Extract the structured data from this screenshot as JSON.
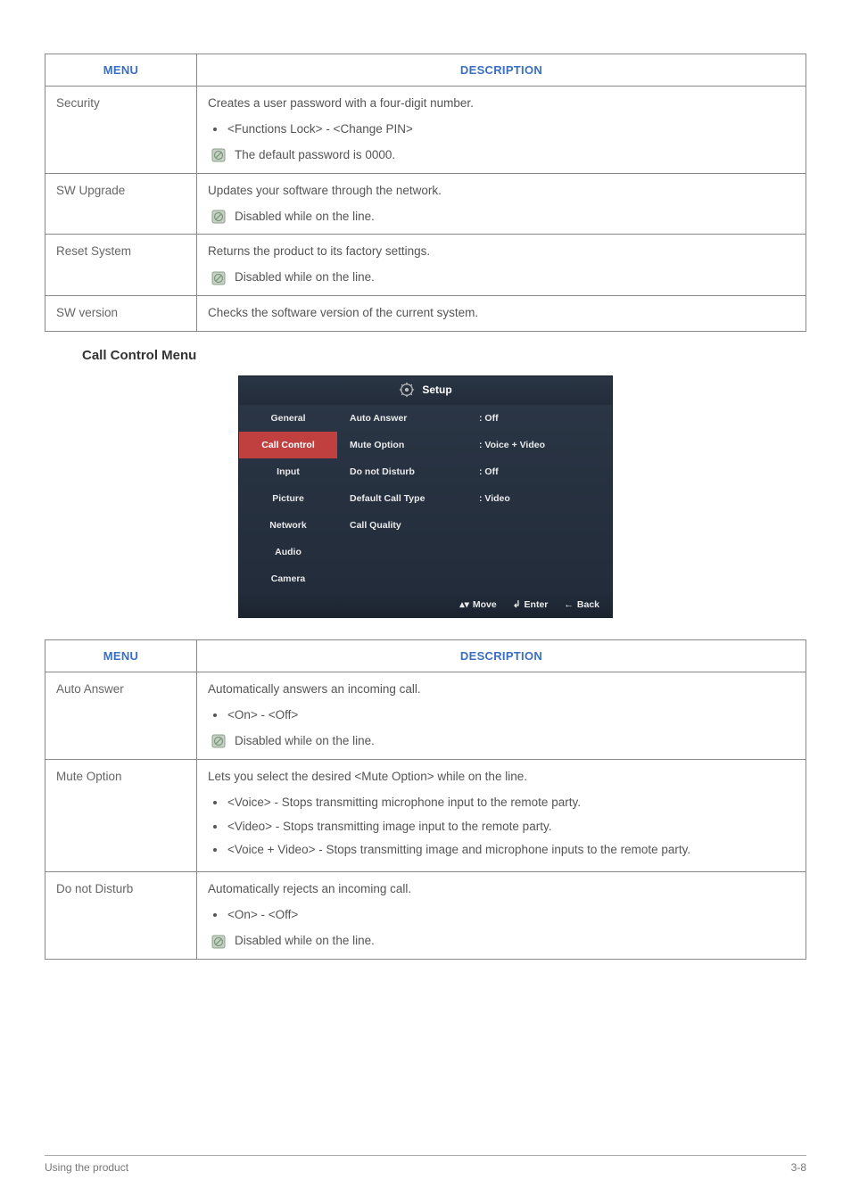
{
  "table1": {
    "head_menu": "MENU",
    "head_desc": "DESCRIPTION",
    "rows": [
      {
        "menu": "Security",
        "desc": "Creates a user password with a four-digit number.",
        "bullets": [
          "<Functions Lock> - <Change PIN>"
        ],
        "note": "The default password is 0000."
      },
      {
        "menu": "SW Upgrade",
        "desc": "Updates your software through the network.",
        "bullets": [],
        "note": "Disabled while on the line."
      },
      {
        "menu": "Reset System",
        "desc": "Returns the product to its factory settings.",
        "bullets": [],
        "note": "Disabled while on the line."
      },
      {
        "menu": "SW version",
        "desc": "Checks the software version of the current system.",
        "bullets": [],
        "note": null
      }
    ]
  },
  "section_heading": "Call Control Menu",
  "osd": {
    "title": "Setup",
    "nav": [
      "General",
      "Call Control",
      "Input",
      "Picture",
      "Network",
      "Audio",
      "Camera"
    ],
    "active_index": 1,
    "rows": [
      {
        "label": "Auto Answer",
        "value": ": Off"
      },
      {
        "label": "Mute Option",
        "value": ": Voice + Video"
      },
      {
        "label": "Do not Disturb",
        "value": ": Off"
      },
      {
        "label": "Default Call Type",
        "value": ": Video"
      },
      {
        "label": "Call Quality",
        "value": ""
      }
    ],
    "footer": {
      "move": "Move",
      "enter": "Enter",
      "back": "Back"
    }
  },
  "table2": {
    "head_menu": "MENU",
    "head_desc": "DESCRIPTION",
    "rows": [
      {
        "menu": "Auto Answer",
        "desc": "Automatically answers an incoming call.",
        "bullets": [
          "<On> - <Off>"
        ],
        "note": "Disabled while on the line."
      },
      {
        "menu": "Mute Option",
        "desc": "Lets you select the desired <Mute Option> while on the line.",
        "bullets": [
          "<Voice> - Stops transmitting microphone input to the remote party.",
          "<Video> - Stops transmitting image input to the remote party.",
          "<Voice + Video> - Stops transmitting image and microphone inputs to the remote party."
        ],
        "note": null
      },
      {
        "menu": "Do not Disturb",
        "desc": "Automatically rejects an incoming call.",
        "bullets": [
          "<On> - <Off>"
        ],
        "note": "Disabled while on the line."
      }
    ]
  },
  "footer": {
    "left": "Using the product",
    "right": "3-8"
  }
}
